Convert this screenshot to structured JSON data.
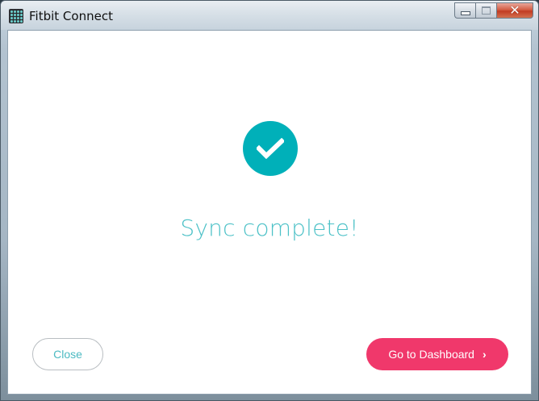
{
  "window": {
    "title": "Fitbit Connect",
    "controls": {
      "minimize_icon": "minimize-icon",
      "maximize_icon": "maximize-icon",
      "close_glyph": "✕"
    }
  },
  "main": {
    "status_icon": "checkmark-icon",
    "message": "Sync complete!",
    "close_label": "Close",
    "dashboard_label": "Go to Dashboard",
    "dashboard_chevron": "›"
  },
  "colors": {
    "accent_teal": "#00b0b9",
    "message_teal": "#4cc1c7",
    "primary_pink": "#f0386b"
  }
}
